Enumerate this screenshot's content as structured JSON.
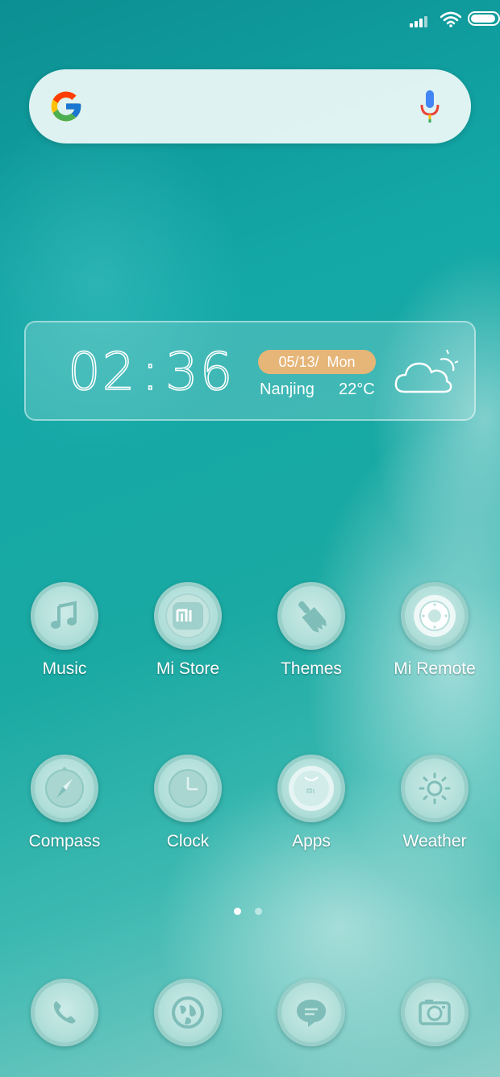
{
  "status_bar": {
    "signal_icon": "signal-icon",
    "wifi_icon": "wifi-icon",
    "battery_icon": "battery-icon",
    "battery_level": 0.95
  },
  "search": {
    "logo": "google-logo",
    "mic_icon": "mic-icon"
  },
  "clock_widget": {
    "time_hours": "02",
    "time_sep": ":",
    "time_minutes": "36",
    "date": "05/13/  Mon",
    "city": "Nanjing",
    "temperature": "22°C",
    "weather_icon": "partly-cloudy-icon"
  },
  "apps_row1": [
    {
      "label": "Music",
      "icon": "music-icon"
    },
    {
      "label": "Mi Store",
      "icon": "mi-store-icon"
    },
    {
      "label": "Themes",
      "icon": "themes-brush-icon"
    },
    {
      "label": "Mi Remote",
      "icon": "remote-icon"
    }
  ],
  "apps_row2": [
    {
      "label": "Compass",
      "icon": "compass-icon"
    },
    {
      "label": "Clock",
      "icon": "clock-icon"
    },
    {
      "label": "Apps",
      "icon": "apps-bag-icon"
    },
    {
      "label": "Weather",
      "icon": "sun-icon"
    }
  ],
  "dock": [
    {
      "icon": "phone-icon"
    },
    {
      "icon": "browser-globe-icon"
    },
    {
      "icon": "messages-icon"
    },
    {
      "icon": "camera-icon"
    }
  ],
  "page_indicator": {
    "pages": 2,
    "current": 1
  },
  "colors": {
    "date_pill": "#e6b578",
    "icon_fill": "#b2dfda",
    "icon_glyph": "#7fbdb8"
  }
}
